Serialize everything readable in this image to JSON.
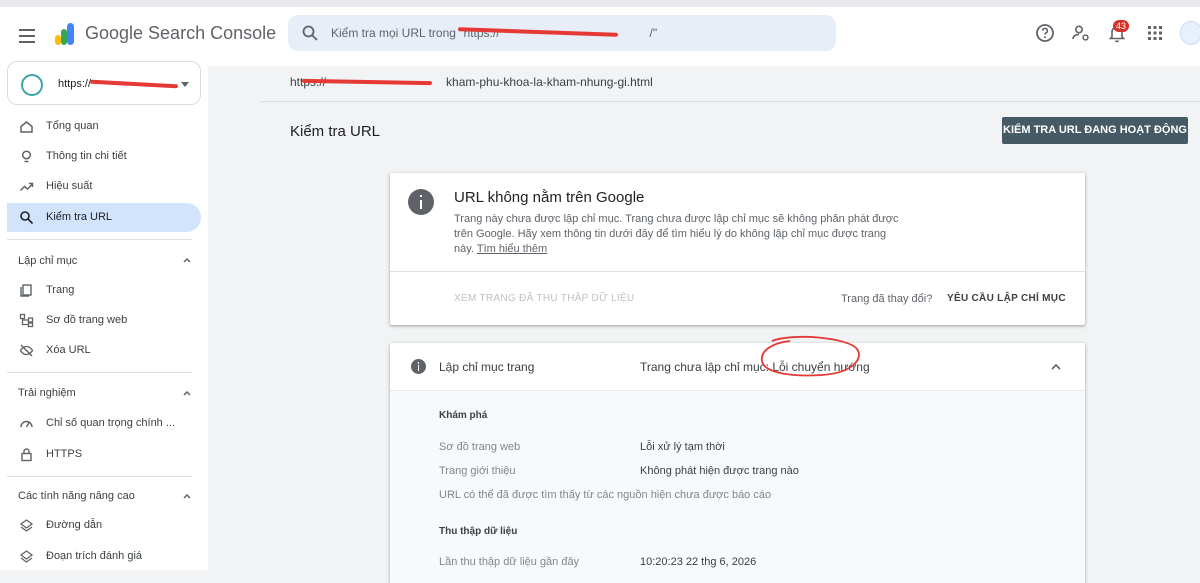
{
  "header": {
    "brand": "Google Search Console",
    "search_placeholder": "Kiểm tra mọi URL trong \"https://",
    "search_suffix": "/\"",
    "notification_count": "43"
  },
  "sidebar": {
    "property": "https://",
    "items": [
      {
        "label": "Tổng quan"
      },
      {
        "label": "Thông tin chi tiết"
      },
      {
        "label": "Hiệu suất"
      },
      {
        "label": "Kiểm tra URL"
      }
    ],
    "sections": [
      {
        "title": "Lập chỉ mục",
        "items": [
          {
            "label": "Trang"
          },
          {
            "label": "Sơ đồ trang web"
          },
          {
            "label": "Xóa URL"
          }
        ]
      },
      {
        "title": "Trải nghiệm",
        "items": [
          {
            "label": "Chỉ số quan trọng chính ..."
          },
          {
            "label": "HTTPS"
          }
        ]
      },
      {
        "title": "Các tính năng nâng cao",
        "items": [
          {
            "label": "Đường dẫn"
          },
          {
            "label": "Đoạn trích đánh giá"
          }
        ]
      }
    ]
  },
  "main": {
    "inspected_url": "https://",
    "inspected_url_suffix": "kham-phu-khoa-la-kham-nhung-gi.html",
    "page_title": "Kiểm tra URL",
    "live_test_button": "KIỂM TRA URL ĐANG HOẠT ĐỘNG",
    "status_card": {
      "title": "URL không nằm trên Google",
      "description": "Trang này chưa được lập chỉ mục. Trang chưa được lập chỉ mục sẽ không phân phát được trên Google. Hãy xem thông tin dưới đây để tìm hiểu lý do không lập chỉ mục được trang này.",
      "learn_more": "Tìm hiểu thêm",
      "view_crawled": "XEM TRANG ĐÃ THU THẬP DỮ LIỆU",
      "page_changed": "Trang đã thay đổi?",
      "request_indexing": "YÊU CẦU LẬP CHỈ MỤC"
    },
    "indexing_card": {
      "label": "Lập chỉ mục trang",
      "value_prefix": "Trang chưa lập chỉ mục:",
      "value_highlight": "Lỗi chuyển hướng",
      "discovery_title": "Khám phá",
      "rows": [
        {
          "label": "Sơ đồ trang web",
          "value": "Lỗi xử lý tạm thời"
        },
        {
          "label": "Trang giới thiệu",
          "value": "Không phát hiện được trang nào"
        },
        {
          "label": "URL có thể đã được tìm thấy từ các nguồn hiện chưa được báo cáo",
          "value": ""
        }
      ],
      "crawl_title": "Thu thập dữ liệu",
      "crawl_rows": [
        {
          "label": "Lần thu thập dữ liệu gần đây",
          "value": "10:20:23 22 thg 6, 2026"
        }
      ]
    }
  },
  "colors": {
    "accent": "#1a73e8",
    "active_nav": "#d2e3fc",
    "button_dark": "#455a64",
    "annotation_red": "#e53935"
  }
}
